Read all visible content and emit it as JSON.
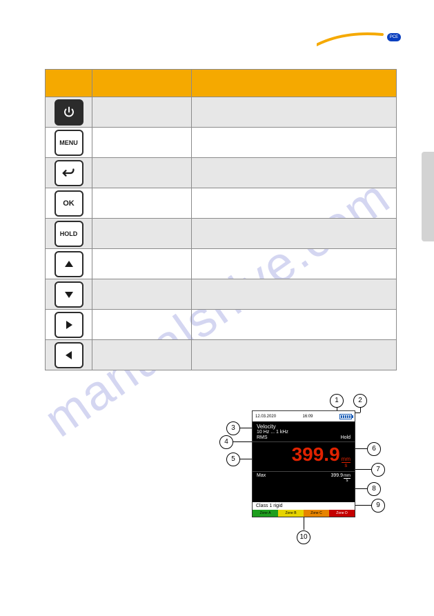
{
  "watermark_text": "manualshive.com",
  "header": {
    "brand_badge": "PCE"
  },
  "keys_table": {
    "headers": [
      "",
      "",
      ""
    ],
    "rows": [
      {
        "icon": "power",
        "label1": "",
        "label2": ""
      },
      {
        "icon": "menu",
        "label1": "",
        "label2": ""
      },
      {
        "icon": "back",
        "label1": "",
        "label2": ""
      },
      {
        "icon": "ok",
        "label1": "",
        "label2": ""
      },
      {
        "icon": "hold",
        "label1": "",
        "label2": ""
      },
      {
        "icon": "up",
        "label1": "",
        "label2": ""
      },
      {
        "icon": "down",
        "label1": "",
        "label2": ""
      },
      {
        "icon": "right",
        "label1": "",
        "label2": ""
      },
      {
        "icon": "left",
        "label1": "",
        "label2": ""
      }
    ],
    "key_text": {
      "menu": "MENU",
      "ok": "OK",
      "hold": "HOLD"
    }
  },
  "lcd": {
    "date": "12.03.2020",
    "time": "16:09",
    "title": "Velocity",
    "range": "10 Hz ... 1 kHz",
    "mode": "RMS",
    "hold": "Hold",
    "value": "399.9",
    "unit_num": "mm",
    "unit_den": "s",
    "max_label": "Max",
    "max_value": "399.9",
    "class_label": "Class 1 rigid",
    "zones": {
      "a": "Zone A",
      "b": "Zone B",
      "c": "Zone C",
      "d": "Zone D"
    }
  },
  "callouts": [
    "1",
    "2",
    "3",
    "4",
    "5",
    "6",
    "7",
    "8",
    "9",
    "10"
  ]
}
